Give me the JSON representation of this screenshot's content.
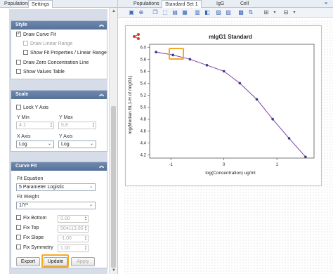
{
  "left_tabs": [
    "Populations",
    "Settings"
  ],
  "right_tabs": [
    "Populations",
    "Standard Set 1",
    "IgG",
    "Cell"
  ],
  "style": {
    "title": "Style",
    "draw_curve_fit": "Draw Curve Fit",
    "draw_linear_range": "Draw Linear Range",
    "show_fit_properties": "Show Fit Properties / Linear Range",
    "draw_zero_line": "Draw Zero Concentration Line",
    "show_values_table": "Show Values Table"
  },
  "scale": {
    "title": "Scale",
    "lock_y_axis": "Lock Y Axis",
    "y_min_label": "Y Min",
    "y_max_label": "Y Max",
    "y_min_value": "4.1",
    "y_max_value": "5.8",
    "x_axis_label": "X Axis",
    "y_axis_label": "Y Axis",
    "x_axis_value": "Log",
    "y_axis_value": "Log"
  },
  "curve_fit": {
    "title": "Curve Fit",
    "fit_equation_label": "Fit Equation",
    "fit_equation_value": "5 Parameter Logistic",
    "fit_weight_label": "Fit Weight",
    "fit_weight_value": "1/Y²",
    "fix_bottom": "Fix Bottom",
    "fix_bottom_value": "0.00",
    "fix_top": "Fix Top",
    "fix_top_value": "504113.00",
    "fix_slope": "Fix Slope",
    "fix_slope_value": "-1.00",
    "fix_symmetry": "Fix Symmetry",
    "fix_symmetry_value": "1.00",
    "export": "Export",
    "update": "Update",
    "apply": "Apply"
  },
  "chart_data": {
    "type": "scatter",
    "title": "mIgG1 Standard",
    "xlabel": "log(Concentration) ug/ml",
    "ylabel": "log(Median BL1-H of mIgG1)",
    "xlim": [
      -1.4,
      1.7
    ],
    "ylim": [
      4.15,
      6.05
    ],
    "xticks": [
      "-1",
      "0",
      "1"
    ],
    "xtick_values": [
      -1,
      0,
      1
    ],
    "yticks": [
      "4.2",
      "4.4",
      "4.6",
      "4.8",
      "5.0",
      "5.2",
      "5.4",
      "5.6",
      "5.8",
      "6.0"
    ],
    "ytick_values": [
      4.2,
      4.4,
      4.6,
      4.8,
      5.0,
      5.2,
      5.4,
      5.6,
      5.8,
      6.0
    ],
    "points": [
      {
        "x": -1.28,
        "y": 5.92
      },
      {
        "x": -0.96,
        "y": 5.87
      },
      {
        "x": -0.64,
        "y": 5.8
      },
      {
        "x": -0.32,
        "y": 5.7
      },
      {
        "x": 0.0,
        "y": 5.6
      },
      {
        "x": 0.3,
        "y": 5.4
      },
      {
        "x": 0.62,
        "y": 5.13
      },
      {
        "x": 0.92,
        "y": 4.8
      },
      {
        "x": 1.23,
        "y": 4.48
      },
      {
        "x": 1.54,
        "y": 4.17
      }
    ],
    "grid": false,
    "colors": {
      "curve": "#7b3fa8",
      "points": "#3a3a8a"
    }
  }
}
